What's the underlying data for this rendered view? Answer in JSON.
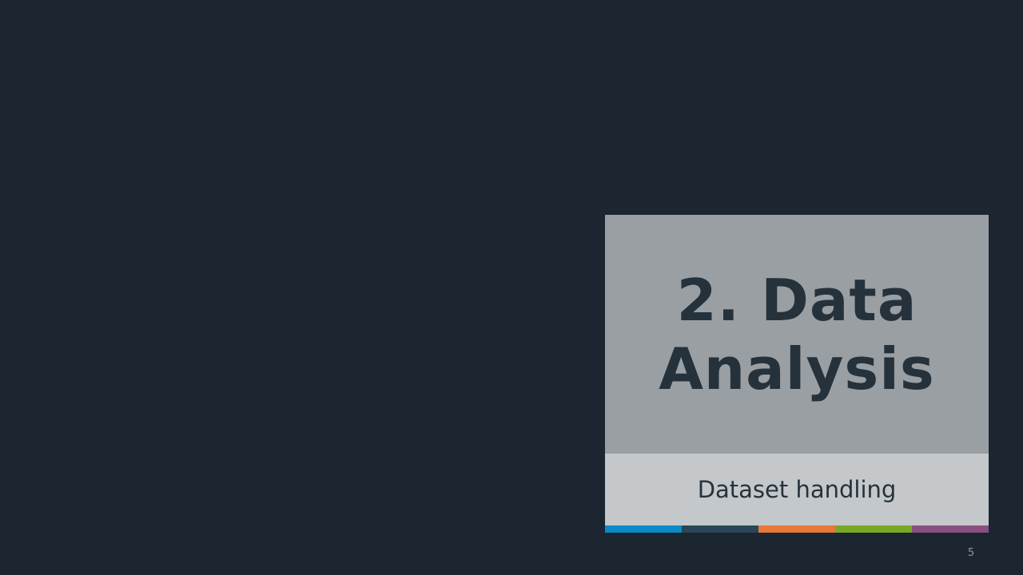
{
  "slide": {
    "title_lines": [
      "2. Data",
      "Analysis"
    ],
    "subtitle": "Dataset handling",
    "page_number": "5"
  },
  "accent_colors": [
    "#0a8ac7",
    "#2a4656",
    "#e8773a",
    "#78a824",
    "#8a4f80"
  ],
  "colors": {
    "background": "#1b2630",
    "title_panel": "#9a9fa3",
    "subtitle_panel": "#c4c8cb",
    "text": "#26323b"
  }
}
